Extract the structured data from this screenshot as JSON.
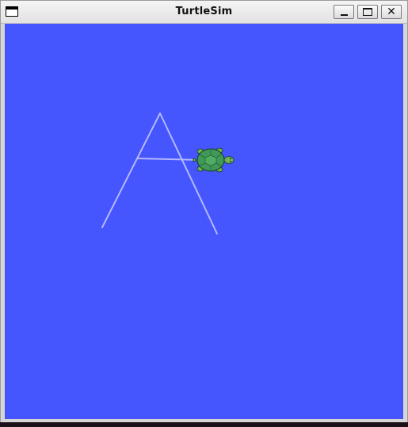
{
  "window": {
    "title": "TurtleSim",
    "controls": {
      "minimize": "minimize",
      "maximize": "maximize",
      "close": "close"
    }
  },
  "canvas": {
    "background_color": "#4556ff",
    "pen_color": "#b3b8ff",
    "turtle_shell_color": "#3f9a5a",
    "turtle_body_color": "#5aa84a"
  }
}
